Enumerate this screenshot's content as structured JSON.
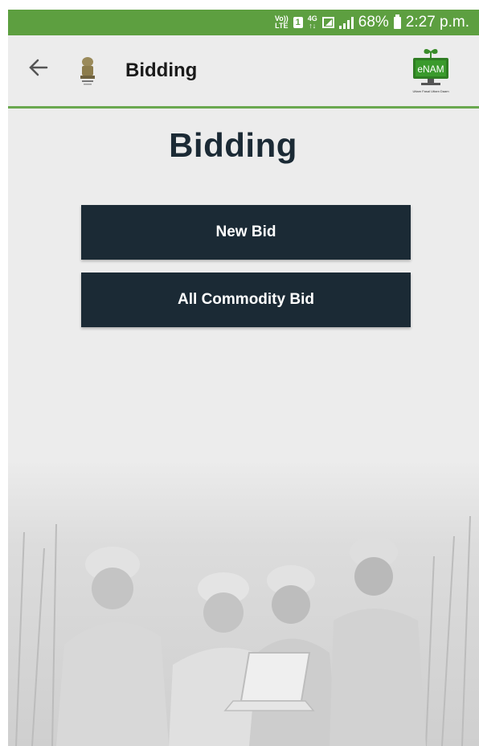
{
  "status_bar": {
    "volte_top": "Vo))",
    "volte_bottom": "LTE",
    "sim_slot": "1",
    "network_top": "4G",
    "network_bottom": "↑↓",
    "signal_icon": "signal-bars-icon",
    "battery_percent": "68%",
    "time": "2:27 p.m."
  },
  "app_bar": {
    "title": "Bidding",
    "logo_text": "eNAM",
    "logo_tagline": "Uttam Fasal Uttam Daam"
  },
  "main": {
    "heading": "Bidding",
    "buttons": [
      {
        "label": "New Bid"
      },
      {
        "label": "All Commodity Bid"
      }
    ]
  },
  "colors": {
    "status_bar": "#5d9f40",
    "button_bg": "#1b2a35",
    "heading": "#1b2a35",
    "background": "#ececec"
  }
}
